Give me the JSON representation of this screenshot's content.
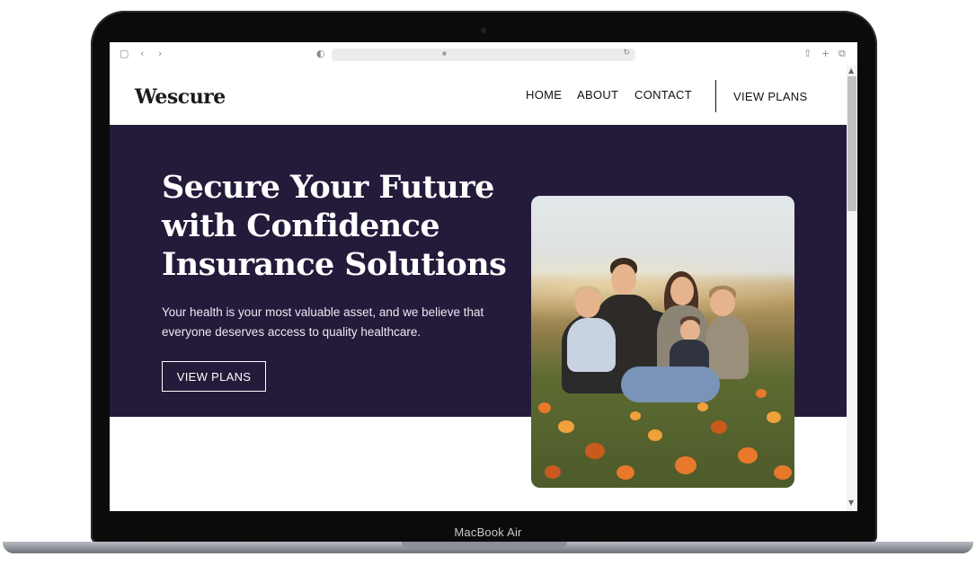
{
  "device": {
    "model_label": "MacBook Air"
  },
  "browser": {
    "icons": [
      "sidebar-icon",
      "back-icon",
      "forward-icon",
      "shield-icon",
      "lock-icon",
      "reload-icon",
      "share-icon",
      "new-tab-icon",
      "tabs-icon"
    ]
  },
  "site": {
    "logo": "Wescure",
    "nav": {
      "home": "HOME",
      "about": "ABOUT",
      "contact": "CONTACT",
      "cta": "VIEW PLANS"
    },
    "hero": {
      "title": "Secure Your Future with Confidence Insurance Solutions",
      "subtitle": "Your health is your most valuable asset, and we believe that everyone deserves access to quality healthcare.",
      "button": "VIEW PLANS"
    },
    "colors": {
      "hero_bg": "#241a3a",
      "text_dark": "#111111",
      "text_light": "#ffffff"
    }
  }
}
